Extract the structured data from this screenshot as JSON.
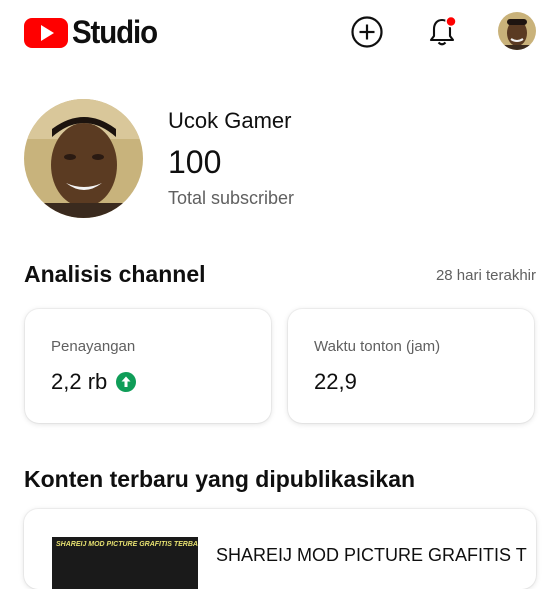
{
  "app": {
    "title": "Studio",
    "logo_icon": "youtube-play-icon",
    "brand_color": "#ff0000"
  },
  "header": {
    "create_icon": "plus-circle-icon",
    "notifications_icon": "bell-icon",
    "notification_badge_color": "#ff0000",
    "account_icon": "avatar"
  },
  "channel": {
    "name": "Ucok Gamer",
    "subscriber_count": "100",
    "subscriber_label": "Total subscriber"
  },
  "analytics": {
    "title": "Analisis channel",
    "period": "28 hari terakhir",
    "cards": [
      {
        "label": "Penayangan",
        "value": "2,2 rb",
        "trend_icon": "arrow-up-circle-icon",
        "trend_color": "#0f9d58"
      },
      {
        "label": "Waktu tonton (jam)",
        "value": "22,9"
      }
    ]
  },
  "latest_content": {
    "title": "Konten terbaru yang dipublikasikan",
    "video": {
      "title": "SHAREIJ MOD PICTURE GRAFITIS T",
      "thumbnail_text": "SHAREIJ MOD PICTURE GRAFITIS TERBARU"
    }
  }
}
